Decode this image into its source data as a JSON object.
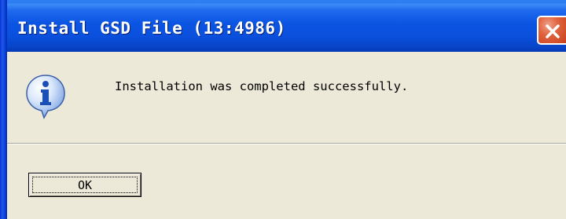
{
  "dialog": {
    "title": "Install GSD File (13:4986)",
    "message": "Installation was completed successfully.",
    "ok_label": "OK"
  },
  "icons": {
    "close": "close-icon",
    "info": "information-icon"
  },
  "colors": {
    "titlebar": "#0a50dd",
    "close_button": "#d9552f",
    "dialog_background": "#ece9d8",
    "info_icon": "#2f6fd0"
  }
}
